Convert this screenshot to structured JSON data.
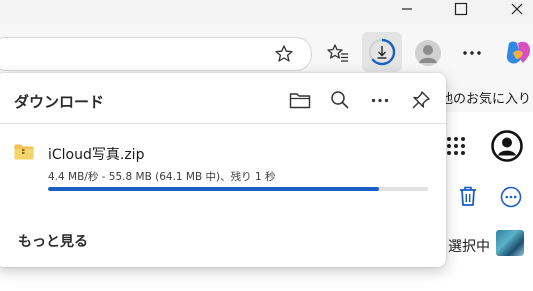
{
  "panel": {
    "title": "ダウンロード",
    "see_more": "もっと見る",
    "download": {
      "file_name": "iCloud写真.zip",
      "status": "4.4 MB/秒 - 55.8 MB (64.1 MB 中)、残り 1 秒",
      "progress_fraction": 0.87
    }
  },
  "favorites": {
    "text": "他のお気に入り"
  },
  "background": {
    "selection_text": "選択中"
  },
  "icons": {
    "minimize": "minimize-icon",
    "maximize": "maximize-icon",
    "close": "close-icon",
    "favorite": "star-icon",
    "favorites": "favorites-icon",
    "downloads": "download-icon",
    "profile": "profile-icon",
    "more": "more-icon",
    "copilot": "copilot-icon",
    "folder": "folder-icon",
    "search": "search-icon",
    "pin": "pin-icon",
    "zip": "zip-folder-icon",
    "apps": "apps-grid-icon",
    "account": "account-icon",
    "trash": "trash-icon"
  },
  "colors": {
    "accent": "#1a5fc4",
    "trash": "#1a5fc4"
  }
}
